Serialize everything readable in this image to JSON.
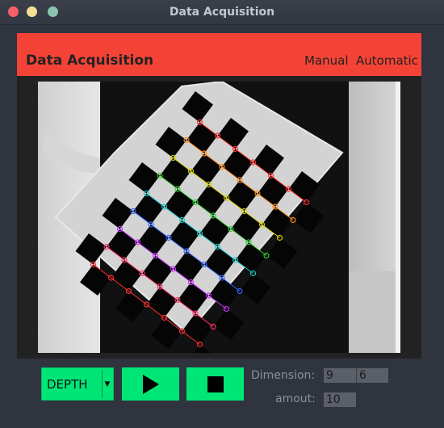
{
  "window": {
    "title": "Data Acquisition"
  },
  "header": {
    "title": "Data Acquisition",
    "nav": [
      "Manual",
      "Automatic"
    ]
  },
  "controls": {
    "mode_value": "DEPTH",
    "dimension_label": "Dimension:",
    "dimension_values": [
      "9",
      "6"
    ],
    "amount_label": "amout:",
    "amount_value": "10"
  },
  "colors": {
    "accent": "#00e676",
    "header": "#f44336",
    "background": "#2f343f"
  },
  "icons": [
    "close-dot",
    "minimize-dot",
    "maximize-dot",
    "chevron-down-icon",
    "play-icon",
    "stop-icon"
  ]
}
